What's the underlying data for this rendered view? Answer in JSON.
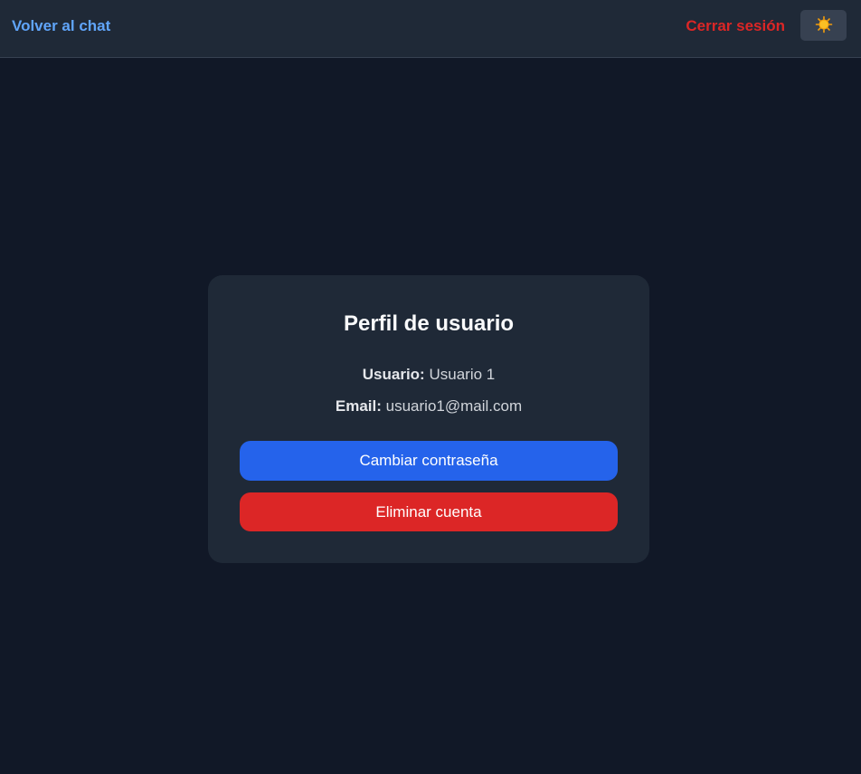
{
  "nav": {
    "back_label": "Volver al chat",
    "logout_label": "Cerrar sesión",
    "theme_toggle_icon": "sun-icon"
  },
  "profile": {
    "title": "Perfil de usuario",
    "user_label": "Usuario:",
    "user_value": "Usuario 1",
    "email_label": "Email:",
    "email_value": "usuario1@mail.com"
  },
  "actions": {
    "change_password_label": "Cambiar contraseña",
    "delete_account_label": "Eliminar cuenta"
  },
  "colors": {
    "background": "#111827",
    "surface": "#1f2937",
    "primary": "#2563eb",
    "danger": "#dc2626",
    "link": "#60a5fa"
  }
}
